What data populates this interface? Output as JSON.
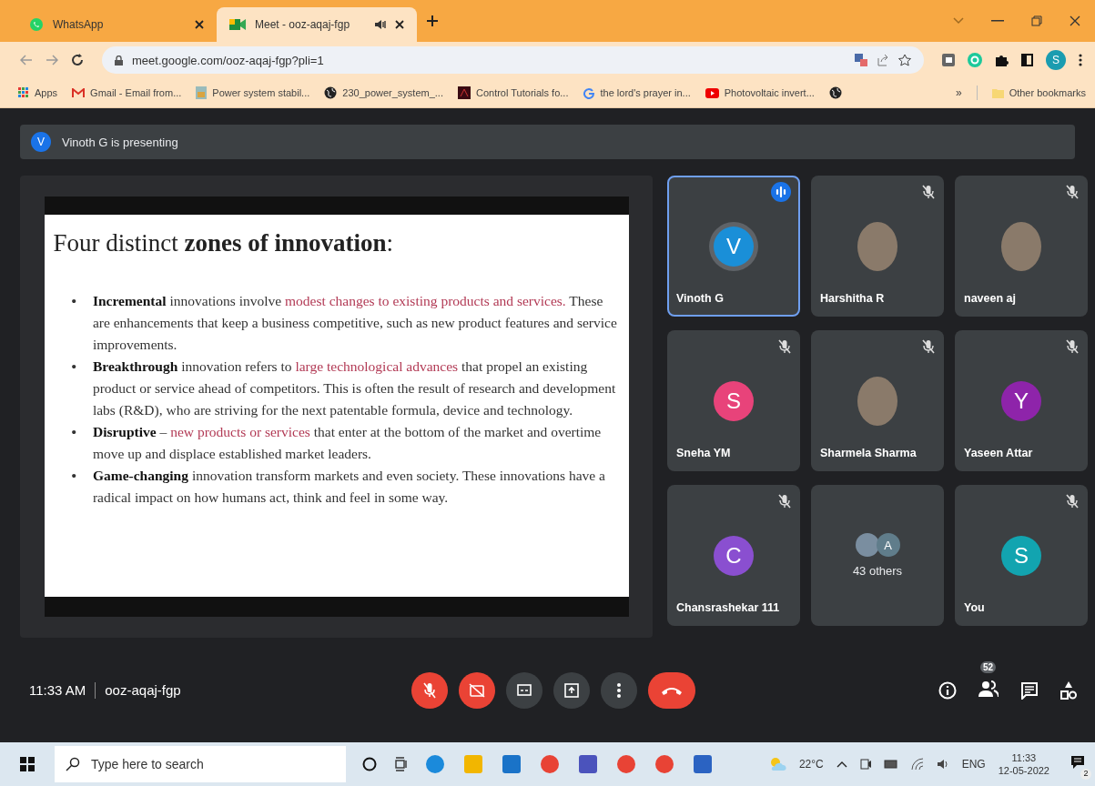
{
  "tabs": [
    {
      "title": "WhatsApp",
      "selected": false,
      "kind": "chat"
    },
    {
      "title": "Meet - ooz-aqaj-fgp",
      "selected": true,
      "kind": "meet"
    }
  ],
  "address": {
    "url": "meet.google.com/ooz-aqaj-fgp?pli=1"
  },
  "profile": {
    "letter": "S"
  },
  "bookmarks": [
    {
      "label": "Apps",
      "kind": "grid"
    },
    {
      "label": "Gmail - Email from...",
      "kind": "mail"
    },
    {
      "label": "Power system stabil...",
      "kind": "doc"
    },
    {
      "label": "230_power_system_...",
      "kind": "globe"
    },
    {
      "label": "Control Tutorials fo...",
      "kind": "square"
    },
    {
      "label": "the lord's prayer in...",
      "kind": "g"
    },
    {
      "label": "Photovoltaic invert...",
      "kind": "video"
    },
    {
      "kind": "globe"
    }
  ],
  "bookmarks_more": "»",
  "other_bookmarks": "Other bookmarks",
  "presenting": {
    "avatar": "V",
    "text": "Vinoth G is presenting"
  },
  "slide": {
    "marker": "•",
    "title": "Four distinct **zones of innovation**:",
    "bullets": [
      [
        {
          "kind": "bold",
          "text": "Incremental"
        },
        {
          "kind": "plain",
          "text": " innovations involve "
        },
        {
          "kind": "red",
          "text": "modest changes to existing products and services."
        },
        {
          "kind": "plain",
          "text": " These are enhancements that keep a business competitive, such as new product features and service improvements."
        }
      ],
      [
        {
          "kind": "bold",
          "text": "Breakthrough"
        },
        {
          "kind": "plain",
          "text": " innovation refers to "
        },
        {
          "kind": "red",
          "text": "large technological advances"
        },
        {
          "kind": "plain",
          "text": " that propel an existing product or service ahead of competitors. This is often the result of research and development labs (R&D), who are striving for the next patentable formula, device and technology."
        }
      ],
      [
        {
          "kind": "bold",
          "text": "Disruptive"
        },
        {
          "kind": "plain",
          "text": " – "
        },
        {
          "kind": "red",
          "text": "new products or services"
        },
        {
          "kind": "plain",
          "text": " that enter at the bottom of the market and overtime move up and displace established market leaders."
        }
      ],
      [
        {
          "kind": "bold",
          "text": "Game-changing"
        },
        {
          "kind": "plain",
          "text": " innovation transform markets and even society. These innovations have a radical impact on how humans act, think and feel in some way."
        }
      ]
    ]
  },
  "tiles": [
    {
      "kind": "initial",
      "name": "Vinoth G",
      "letter": "V",
      "color": "#1a8fd8",
      "speaking": true,
      "muted": false
    },
    {
      "kind": "photo",
      "name": "Harshitha R",
      "speaking": false,
      "muted": true
    },
    {
      "kind": "photo",
      "name": "naveen aj",
      "speaking": false,
      "muted": true
    },
    {
      "kind": "initial",
      "name": "Sneha YM",
      "letter": "S",
      "color": "#e8437a",
      "speaking": false,
      "muted": true
    },
    {
      "kind": "photo",
      "name": "Sharmela Sharma",
      "speaking": false,
      "muted": true
    },
    {
      "kind": "initial",
      "name": "Yaseen Attar",
      "letter": "Y",
      "color": "#8e24aa",
      "speaking": false,
      "muted": true
    },
    {
      "kind": "initial",
      "name": "Chansrashekar 111",
      "letter": "C",
      "color": "#8a4fd0",
      "speaking": false,
      "muted": true
    },
    {
      "kind": "others",
      "name": "43 others",
      "letter": "A",
      "color": "#607d8b",
      "speaking": false,
      "muted": false
    },
    {
      "kind": "initial",
      "name": "You",
      "letter": "S",
      "color": "#12a4b0",
      "speaking": false,
      "muted": true
    }
  ],
  "meeting": {
    "time": "11:33 AM",
    "code": "ooz-aqaj-fgp"
  },
  "controls": [
    {
      "kind": "mic",
      "off": true
    },
    {
      "kind": "camera",
      "off": true
    },
    {
      "kind": "captions"
    },
    {
      "kind": "present"
    },
    {
      "kind": "more"
    },
    {
      "kind": "end"
    }
  ],
  "side_controls": [
    {
      "kind": "info"
    },
    {
      "kind": "people",
      "badge": "52"
    },
    {
      "kind": "chat"
    },
    {
      "kind": "activities"
    }
  ],
  "taskbar": {
    "search_placeholder": "Type here to search",
    "apps": [
      {
        "kind": "cortana"
      },
      {
        "kind": "taskview"
      },
      {
        "kind": "edge"
      },
      {
        "kind": "files"
      },
      {
        "kind": "mail"
      },
      {
        "kind": "chrome"
      },
      {
        "kind": "teams"
      },
      {
        "kind": "chrome"
      },
      {
        "kind": "chrome"
      },
      {
        "kind": "word"
      }
    ],
    "temperature": "22°C",
    "language": "ENG",
    "time": "11:33",
    "date": "12-05-2022",
    "notifications": "2"
  }
}
